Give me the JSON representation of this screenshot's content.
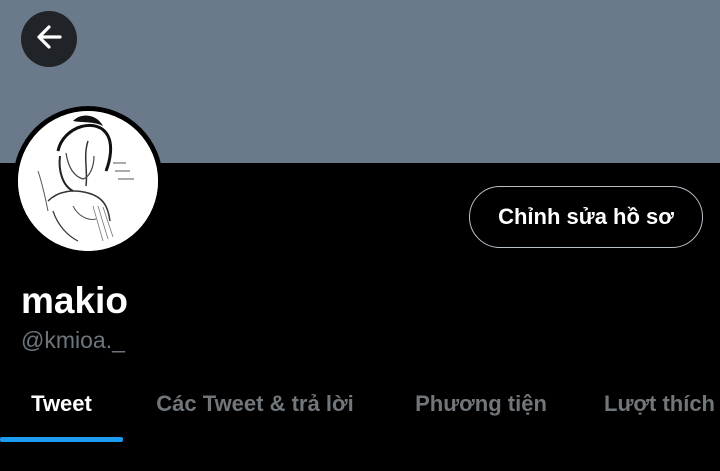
{
  "banner": {
    "color": "#6b7a8a"
  },
  "nav": {
    "back_icon": "arrow-left-icon"
  },
  "profile": {
    "display_name": "makio",
    "handle": "@kmioa._",
    "edit_button_label": "Chỉnh sửa hồ sơ"
  },
  "tabs": [
    {
      "label": "Tweet",
      "active": true
    },
    {
      "label": "Các Tweet & trả lời",
      "active": false
    },
    {
      "label": "Phương tiện",
      "active": false
    },
    {
      "label": "Lượt thích",
      "active": false
    }
  ],
  "colors": {
    "background": "#000000",
    "accent": "#1d9bf0",
    "muted_text": "#6e767d"
  }
}
